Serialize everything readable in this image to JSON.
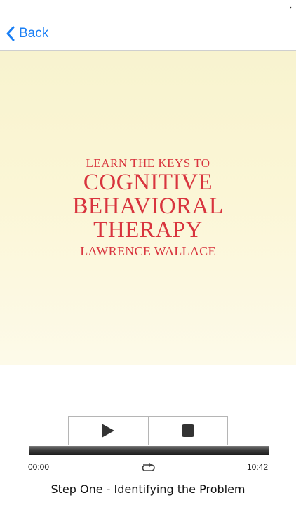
{
  "nav": {
    "back_label": "Back"
  },
  "cover": {
    "pre_title": "LEARN THE KEYS TO",
    "title_line1": "COGNITIVE",
    "title_line2": "BEHAVIORAL",
    "title_line3": "THERAPY",
    "author": "LAWRENCE WALLACE"
  },
  "player": {
    "play_icon": "play-icon",
    "stop_icon": "stop-icon",
    "repeat_icon": "repeat-icon",
    "elapsed": "00:00",
    "total": "10:42",
    "progress": 0,
    "track_title": "Step One - Identifying the Problem"
  },
  "colors": {
    "accent": "#1a7ff5",
    "cover_text": "#d8343e",
    "cover_bg": "#f8f3cf"
  }
}
